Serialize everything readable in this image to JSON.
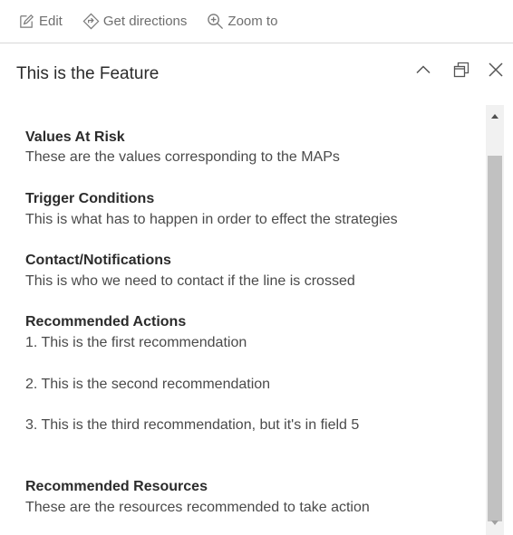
{
  "toolbar": {
    "edit_label": "Edit",
    "directions_label": "Get directions",
    "zoom_label": "Zoom to"
  },
  "header": {
    "title": "This is the Feature"
  },
  "fields": [
    {
      "label": "Values At Risk",
      "value": "These are the values corresponding to the MAPs"
    },
    {
      "label": "Trigger Conditions",
      "value": "This is what has to happen in order to effect the strategies"
    },
    {
      "label": "Contact/Notifications",
      "value": "This is who we need to contact if the line is crossed"
    },
    {
      "label": "Recommended Actions",
      "lines": [
        "1. This is the first recommendation",
        "2. This is the second recommendation",
        "3. This is the third recommendation, but it's in field 5"
      ]
    },
    {
      "label": "Recommended Resources",
      "value": "These are the resources recommended to take action"
    }
  ],
  "colors": {
    "text": "#323232",
    "muted": "#6e6e6e",
    "scroll_thumb": "#c1c1c1"
  },
  "icons": [
    "edit-icon",
    "directions-icon",
    "zoom-in-icon",
    "chevron-up-icon",
    "dock-icon",
    "close-icon"
  ]
}
